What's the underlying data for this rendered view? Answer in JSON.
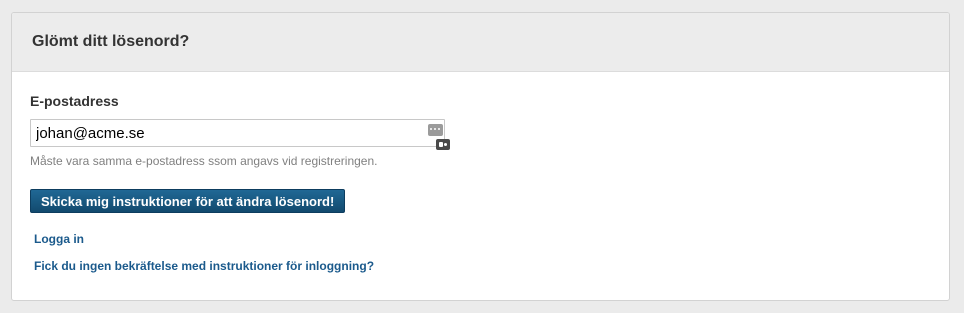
{
  "header": {
    "title": "Glömt ditt lösenord?"
  },
  "form": {
    "email_label": "E-postadress",
    "email_value": "johan@acme.se",
    "email_placeholder": "",
    "email_help": "Måste vara samma e-postadress ssom angavs vid registreringen.",
    "submit_label": "Skicka mig instruktioner för att ändra lösenord!"
  },
  "links": {
    "login": "Logga in",
    "confirmation": "Fick du ingen bekräftelse med instruktioner för inloggning?"
  },
  "icons": {
    "autofill": "password-autofill-icon",
    "keychain": "keychain-icon"
  },
  "colors": {
    "button_bg": "#1a5a82",
    "link": "#1b5a8c",
    "header_bg": "#ececec",
    "page_bg": "#ebebeb"
  }
}
